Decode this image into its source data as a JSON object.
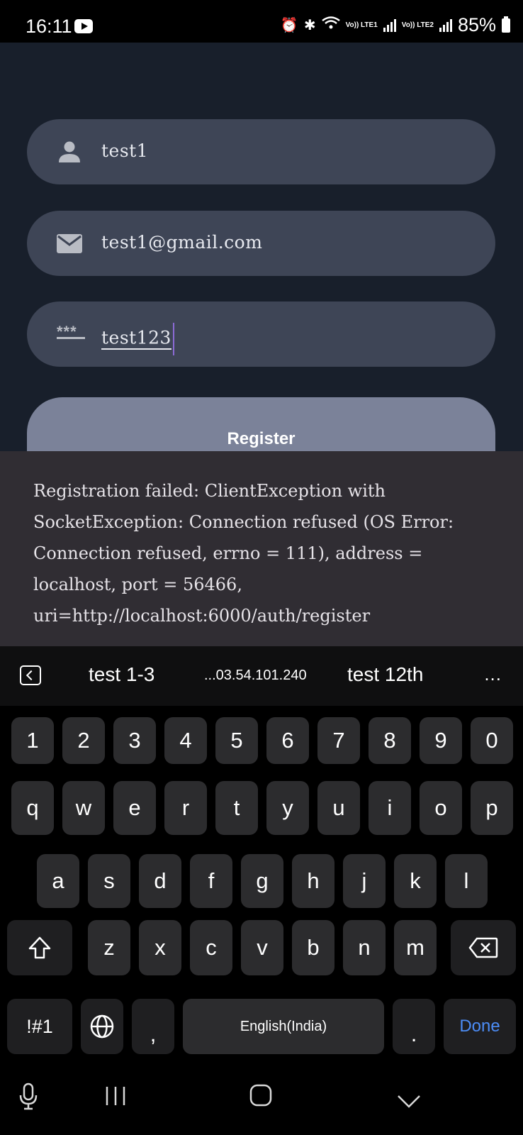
{
  "status_bar": {
    "time": "16:11",
    "sim1_label": "Vo)) LTE1",
    "sim2_label": "Vo)) LTE2",
    "battery": "85%"
  },
  "form": {
    "username": "test1",
    "email": "test1@gmail.com",
    "password_mask": "***",
    "password": "test123",
    "register_label": "Register"
  },
  "snackbar": {
    "message": "Registration failed: ClientException with SocketException: Connection refused (OS Error: Connection refused, errno = 111), address = localhost, port = 56466, uri=http://localhost:6000/auth/register"
  },
  "suggestions": [
    "test 1-3",
    "...03.54.101.240",
    "test 12th"
  ],
  "more_label": "...",
  "keyboard": {
    "row_numbers": [
      "1",
      "2",
      "3",
      "4",
      "5",
      "6",
      "7",
      "8",
      "9",
      "0"
    ],
    "row_q": [
      "q",
      "w",
      "e",
      "r",
      "t",
      "y",
      "u",
      "i",
      "o",
      "p"
    ],
    "row_a": [
      "a",
      "s",
      "d",
      "f",
      "g",
      "h",
      "j",
      "k",
      "l"
    ],
    "row_z": [
      "z",
      "x",
      "c",
      "v",
      "b",
      "n",
      "m"
    ],
    "symbols_label": "!#1",
    "comma": ",",
    "space_label": "English(India)",
    "period": ".",
    "done_label": "Done"
  },
  "colors": {
    "app_bg": "#181f2b",
    "field_bg": "#3e4556",
    "register_bg": "#7b8299",
    "snackbar_bg": "#302d33",
    "done_blue": "#4c8cf5"
  },
  "icons": [
    "person-icon",
    "email-icon",
    "password-icon",
    "backspace-icon",
    "shift-icon",
    "globe-icon",
    "mic-icon"
  ]
}
